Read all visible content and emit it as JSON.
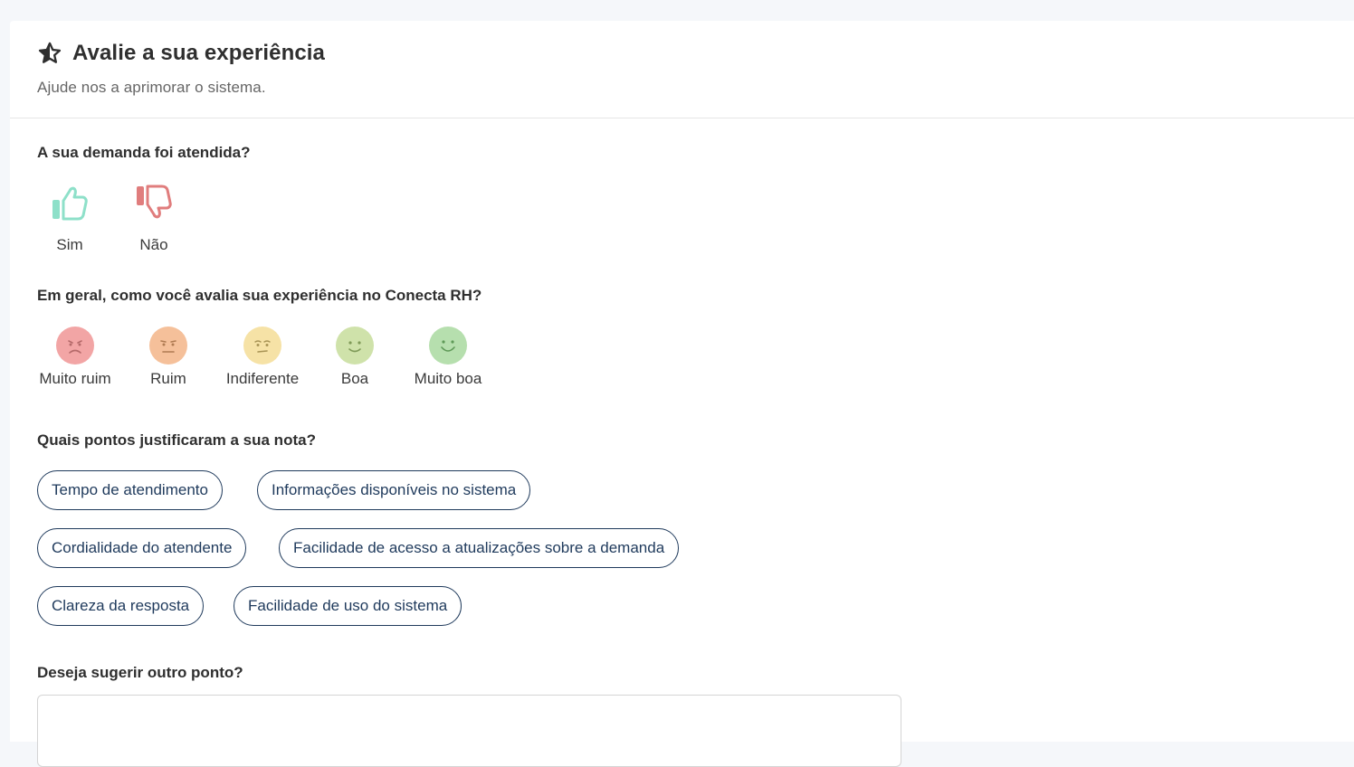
{
  "header": {
    "title": "Avalie a sua experiência",
    "subtitle": "Ajude nos a aprimorar o sistema."
  },
  "q1": {
    "label": "A sua demanda foi atendida?",
    "options": [
      {
        "label": "Sim",
        "icon": "thumbs-up-icon",
        "color": "#8ee0c9"
      },
      {
        "label": "Não",
        "icon": "thumbs-down-icon",
        "color": "#e07d7d"
      }
    ]
  },
  "q2": {
    "label": "Em geral, como você avalia sua experiência no Conecta RH?",
    "options": [
      {
        "label": "Muito ruim",
        "icon": "very-bad-face-icon",
        "color": "#f2a5a5"
      },
      {
        "label": "Ruim",
        "icon": "bad-face-icon",
        "color": "#f5c09a"
      },
      {
        "label": "Indiferente",
        "icon": "neutral-face-icon",
        "color": "#f6e2a6"
      },
      {
        "label": "Boa",
        "icon": "good-face-icon",
        "color": "#cfe2aa"
      },
      {
        "label": "Muito boa",
        "icon": "very-good-face-icon",
        "color": "#b6dfae"
      }
    ]
  },
  "q3": {
    "label": "Quais pontos justificaram a sua nota?",
    "chips": [
      "Tempo de atendimento",
      "Informações disponíveis no sistema",
      "Cordialidade do atendente",
      "Facilidade de acesso a atualizações sobre a demanda",
      "Clareza da resposta",
      "Facilidade de uso do sistema"
    ]
  },
  "q4": {
    "label": "Deseja sugerir outro ponto?",
    "value": ""
  }
}
